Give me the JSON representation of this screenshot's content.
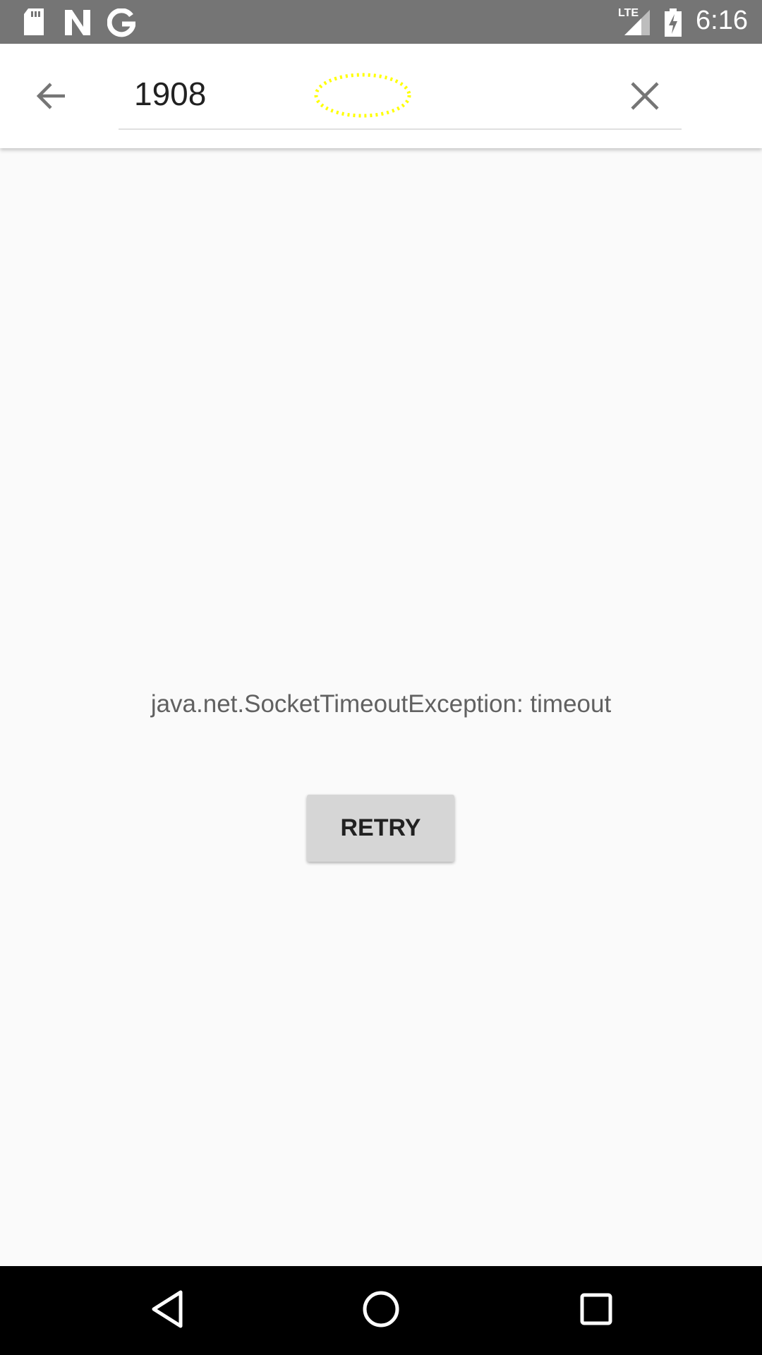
{
  "status_bar": {
    "time": "6:16",
    "network": "LTE",
    "icons": [
      "sd-card-icon",
      "n-icon",
      "google-icon",
      "signal-icon",
      "battery-charging-icon"
    ]
  },
  "search": {
    "query": "1908"
  },
  "error": {
    "message": "java.net.SocketTimeoutException: timeout",
    "retry_label": "RETRY"
  },
  "colors": {
    "status_bar": "#757575",
    "highlight": "#ffff00"
  }
}
